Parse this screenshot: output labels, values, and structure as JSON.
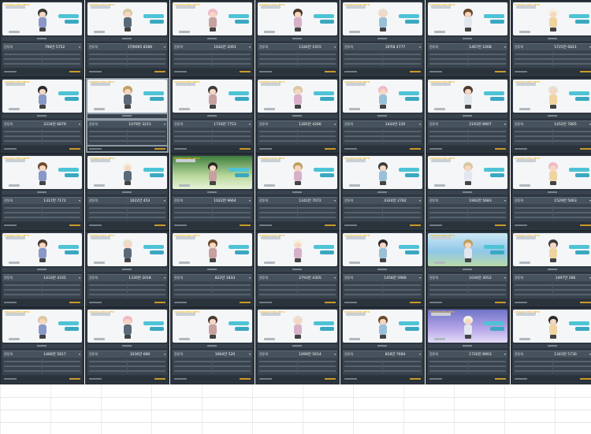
{
  "panel_tag": "CHARACTER INFO",
  "stat_label": "전투력",
  "arrow_icon": "chevron-right-icon",
  "cards": [
    {
      "power": "796만 5752"
    },
    {
      "power": "1억9095 8589"
    },
    {
      "power": "1642만 2091"
    },
    {
      "power": "1184만 1915"
    },
    {
      "power": "16억8 4777"
    },
    {
      "power": "1467만 1008"
    },
    {
      "power": "5725만 6821"
    },
    {
      "power": "2234만 6879"
    },
    {
      "power": "1079만 3215"
    },
    {
      "power": "1716만 7753"
    },
    {
      "power": "1285만 4266"
    },
    {
      "power": "1444만 220"
    },
    {
      "power": "2193만 8907"
    },
    {
      "power": "1452만 7805"
    },
    {
      "power": "1317만 7172"
    },
    {
      "power": "1022만 453"
    },
    {
      "power": "1022만 9664"
    },
    {
      "power": "1241만 7072"
    },
    {
      "power": "4324만 2782"
    },
    {
      "power": "1962만 5683"
    },
    {
      "power": "1529만 5063"
    },
    {
      "power": "1433만 4335"
    },
    {
      "power": "1330만 2018"
    },
    {
      "power": "822만 1833"
    },
    {
      "power": "2793만 4305"
    },
    {
      "power": "1458만 5966"
    },
    {
      "power": "1034만 3052"
    },
    {
      "power": "1497만 266"
    },
    {
      "power": "1466만 5817"
    },
    {
      "power": "1036만 690"
    },
    {
      "power": "1064만 520"
    },
    {
      "power": "1099만 5614"
    },
    {
      "power": "818만 7694"
    },
    {
      "power": "1726만 8903"
    },
    {
      "power": "1343만 5730"
    }
  ]
}
